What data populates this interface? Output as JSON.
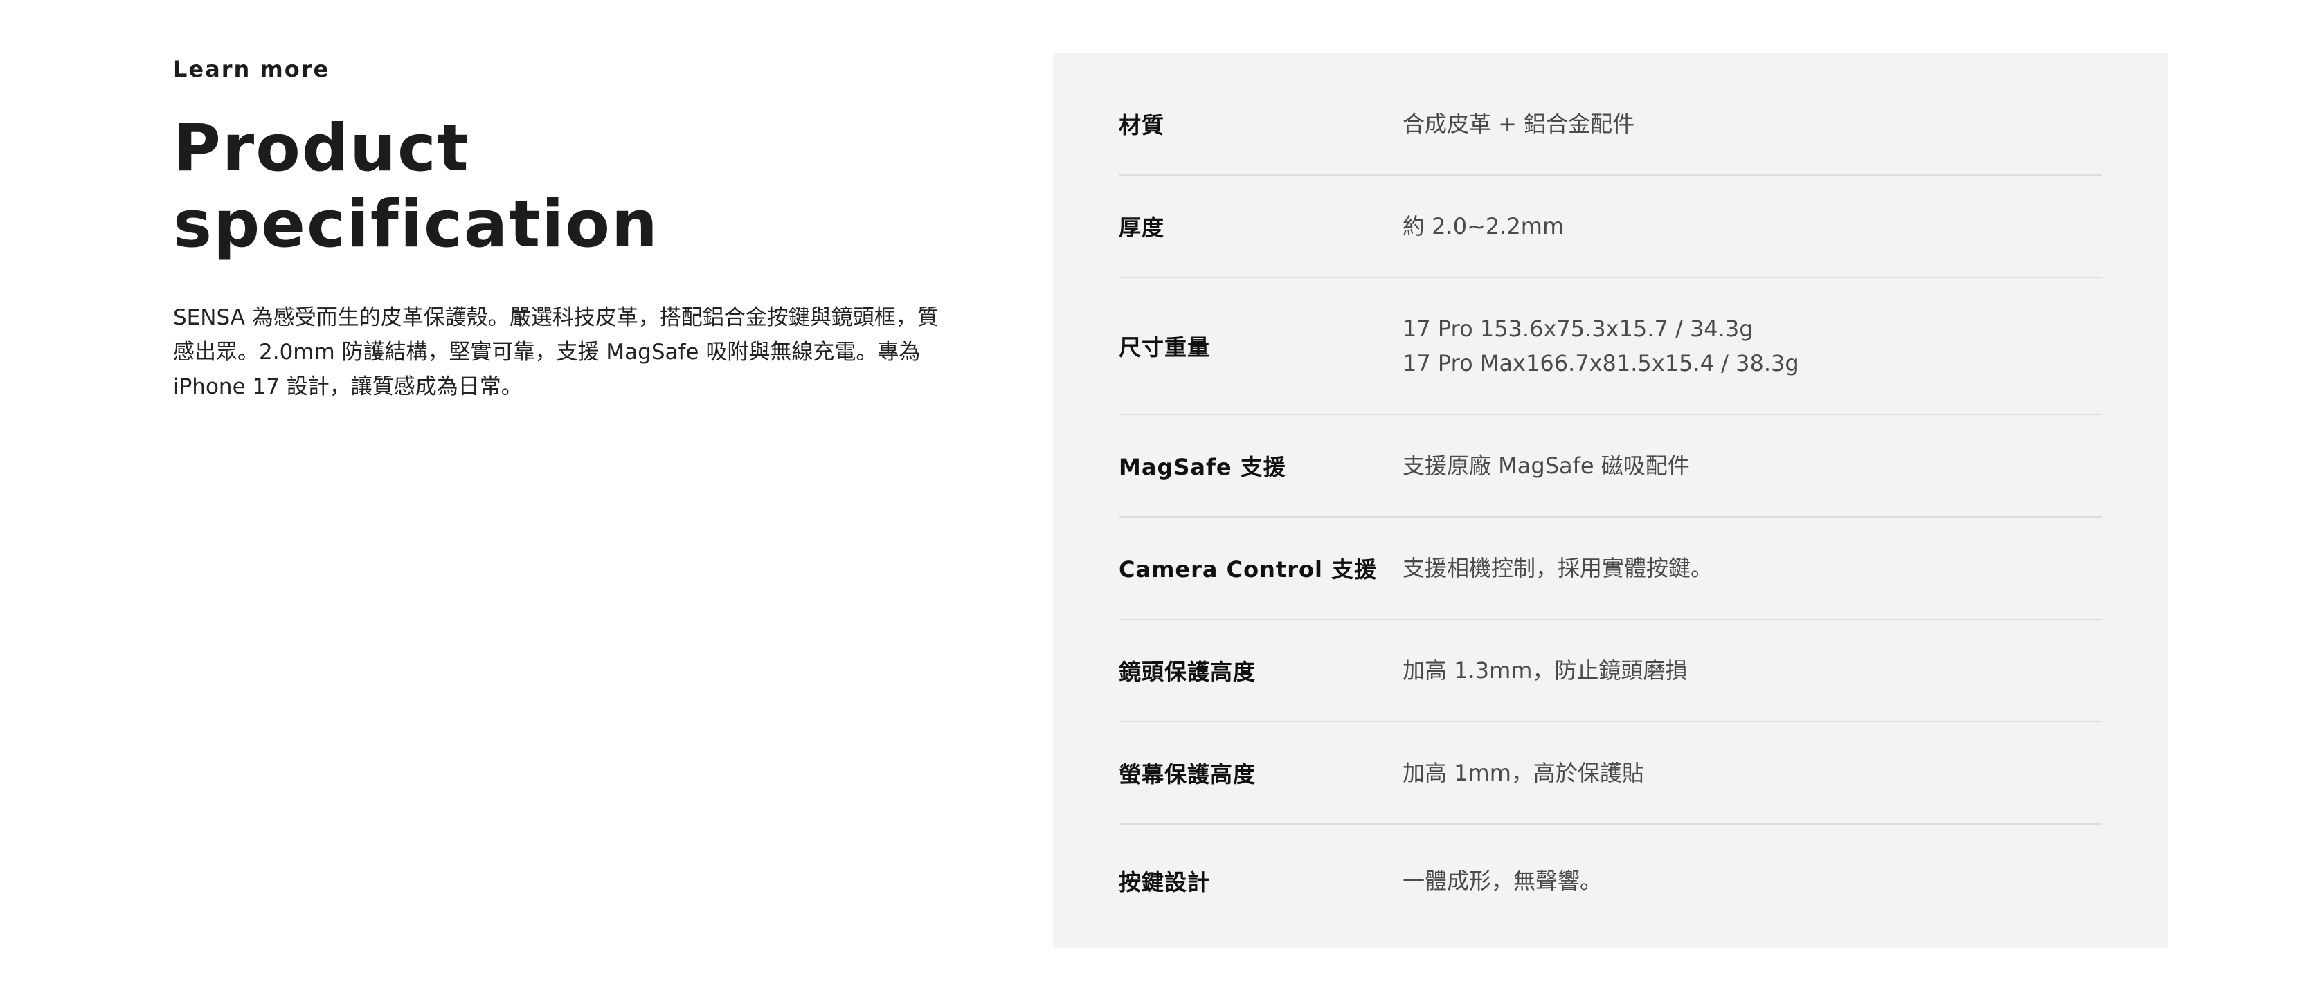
{
  "intro": {
    "eyebrow": "Learn more",
    "title": "Product specification",
    "description": "SENSA 為感受而生的皮革保護殼。嚴選科技皮革，搭配鋁合金按鍵與鏡頭框，質感出眾。2.0mm 防護結構，堅實可靠，支援 MagSafe 吸附與無線充電。專為 iPhone 17 設計，讓質感成為日常。"
  },
  "specs": [
    {
      "label": "材質",
      "value": "合成皮革 + 鋁合金配件"
    },
    {
      "label": "厚度",
      "value": "約 2.0~2.2mm"
    },
    {
      "label": "尺寸重量",
      "value_lines": [
        "17 Pro 153.6x75.3x15.7 / 34.3g",
        "17 Pro Max166.7x81.5x15.4 / 38.3g"
      ]
    },
    {
      "label": "MagSafe 支援",
      "value": "支援原廠 MagSafe 磁吸配件"
    },
    {
      "label": "Camera Control 支援",
      "value": "支援相機控制，採用實體按鍵。"
    },
    {
      "label": "鏡頭保護高度",
      "value": "加高 1.3mm，防止鏡頭磨損"
    },
    {
      "label": "螢幕保護高度",
      "value": "加高 1mm，高於保護貼"
    },
    {
      "label": "按鍵設計",
      "value": "一體成形，無聲響。"
    }
  ]
}
